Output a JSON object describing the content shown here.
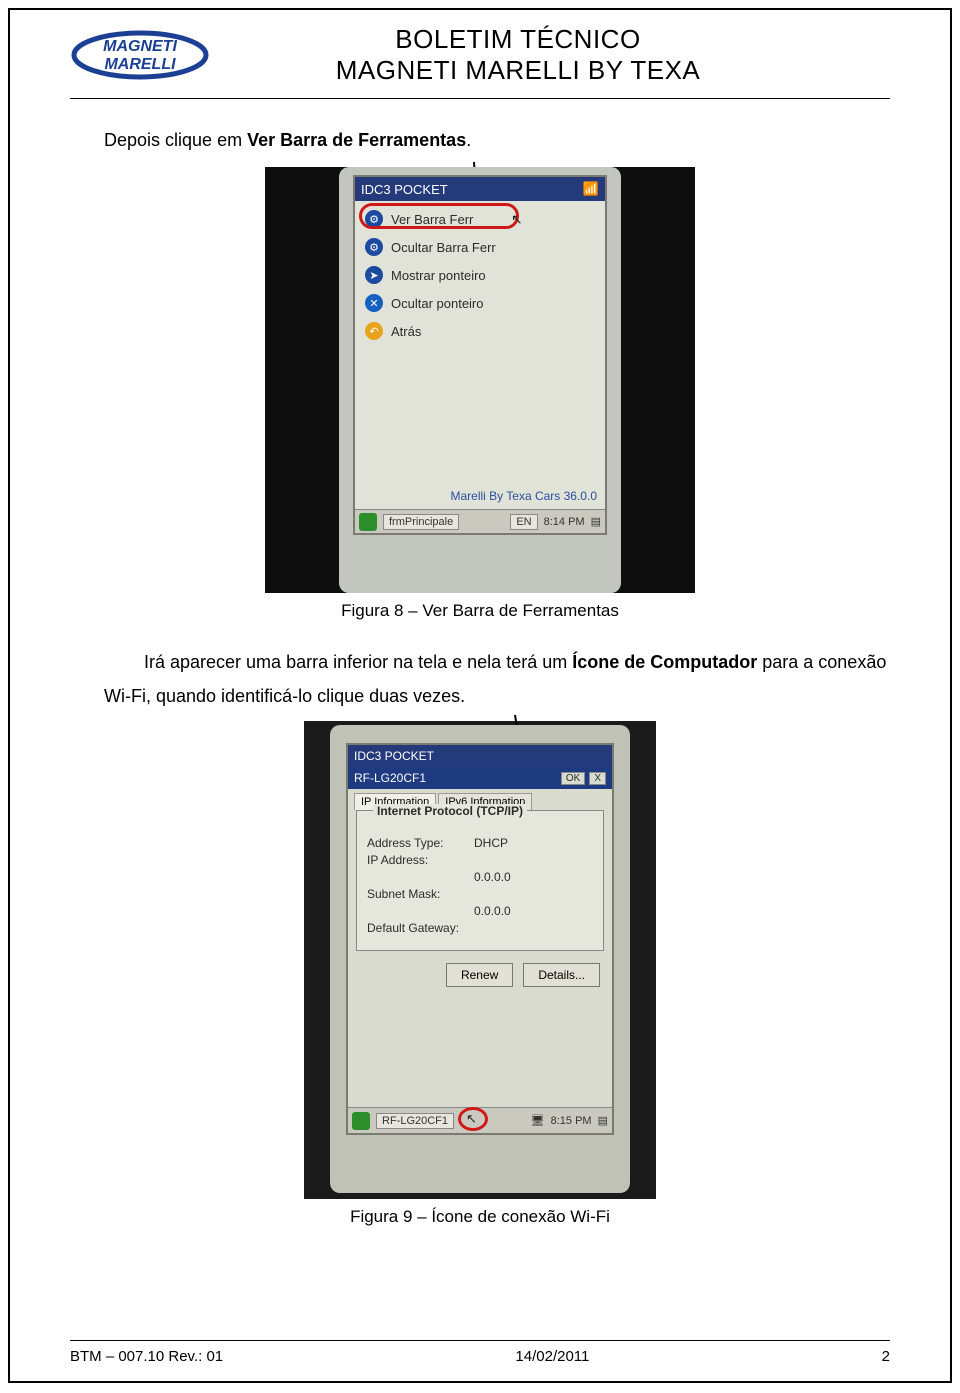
{
  "header": {
    "logo_text_top": "MAGNETI",
    "logo_text_bottom": "MARELLI",
    "title1": "BOLETIM TÉCNICO",
    "title2": "MAGNETI MARELLI BY TEXA"
  },
  "para1": {
    "pre": "Depois clique em ",
    "bold": "Ver Barra de Ferramentas",
    "post": "."
  },
  "fig8": {
    "caption": "Figura 8 – Ver Barra de Ferramentas",
    "titlebar": "IDC3 POCKET",
    "items": [
      "Ver Barra Ferr",
      "Ocultar Barra Ferr",
      "Mostrar ponteiro",
      "Ocultar ponteiro",
      "Atrás"
    ],
    "brand": "Marelli By Texa Cars 36.0.0",
    "task_app": "frmPrincipale",
    "task_lang": "EN",
    "task_time": "8:14 PM"
  },
  "para2": {
    "line1_pre": "Irá aparecer uma barra inferior na tela e nela terá um ",
    "line1_bold": "Ícone de Computador",
    "line1_post": " para a conexão",
    "line2": "Wi-Fi, quando identificá-lo clique duas vezes."
  },
  "fig9": {
    "caption": "Figura 9 – Ícone de conexão Wi-Fi",
    "titlebar": "IDC3 POCKET",
    "subtitle": "RF-LG20CF1",
    "ok": "OK",
    "close": "X",
    "tabs": [
      "IP Information",
      "IPv6 Information"
    ],
    "legend": "Internet Protocol (TCP/IP)",
    "rows": [
      {
        "lab": "Address Type:",
        "val": "DHCP"
      },
      {
        "lab": "IP Address:",
        "val": ""
      },
      {
        "lab": "",
        "val": "0.0.0.0"
      },
      {
        "lab": "Subnet Mask:",
        "val": ""
      },
      {
        "lab": "",
        "val": "0.0.0.0"
      },
      {
        "lab": "Default Gateway:",
        "val": ""
      }
    ],
    "btn_renew": "Renew",
    "btn_details": "Details...",
    "task_app": "RF-LG20CF1",
    "task_time": "8:15 PM"
  },
  "footer": {
    "left": "BTM – 007.10 Rev.: 01",
    "center": "14/02/2011",
    "right": "2"
  }
}
